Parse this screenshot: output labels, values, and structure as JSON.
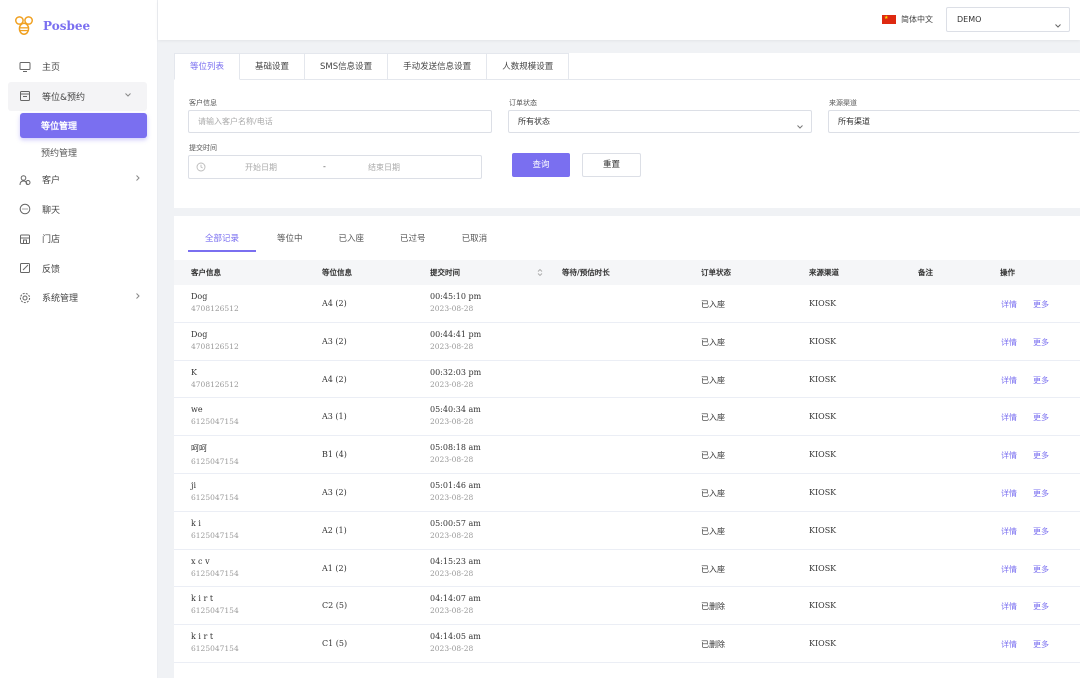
{
  "app": {
    "name": "Posbee"
  },
  "header": {
    "language": "简体中文",
    "store": "DEMO"
  },
  "sidebar": {
    "items": [
      {
        "label": "主页",
        "icon": "monitor-icon"
      },
      {
        "label": "等位&预约",
        "icon": "queue-icon",
        "open": true,
        "children": [
          {
            "label": "等位管理",
            "active": true
          },
          {
            "label": "预约管理"
          }
        ]
      },
      {
        "label": "客户",
        "icon": "customers-icon",
        "has_children": true
      },
      {
        "label": "聊天",
        "icon": "chat-icon"
      },
      {
        "label": "门店",
        "icon": "store-icon"
      },
      {
        "label": "反馈",
        "icon": "feedback-icon"
      },
      {
        "label": "系统管理",
        "icon": "settings-icon",
        "has_children": true
      }
    ]
  },
  "top_tabs": [
    "等位列表",
    "基础设置",
    "SMS信息设置",
    "手动发送信息设置",
    "人数规模设置"
  ],
  "filters": {
    "customer_label": "客户信息",
    "customer_placeholder": "请输入客户名称/电话",
    "status_label": "订单状态",
    "status_value": "所有状态",
    "channel_label": "来源渠道",
    "channel_value": "所有渠道",
    "time_label": "提交时间",
    "start_placeholder": "开始日期",
    "separator": "-",
    "end_placeholder": "结束日期",
    "search_label": "查询",
    "reset_label": "重置"
  },
  "sub_tabs": [
    "全部记录",
    "等位中",
    "已入座",
    "已过号",
    "已取消"
  ],
  "table": {
    "headers": [
      "客户信息",
      "等位信息",
      "提交时间",
      "等待/预估时长",
      "订单状态",
      "来源渠道",
      "备注",
      "操作"
    ],
    "action_detail": "详情",
    "action_more": "更多",
    "rows": [
      {
        "name": "Dog",
        "phone": "4708126512",
        "queue": "A4 (2)",
        "time": "00:45:10 pm",
        "date": "2023-08-28",
        "status": "已入座",
        "channel": "KIOSK"
      },
      {
        "name": "Dog",
        "phone": "4708126512",
        "queue": "A3 (2)",
        "time": "00:44:41 pm",
        "date": "2023-08-28",
        "status": "已入座",
        "channel": "KIOSK"
      },
      {
        "name": "K",
        "phone": "4708126512",
        "queue": "A4 (2)",
        "time": "00:32:03 pm",
        "date": "2023-08-28",
        "status": "已入座",
        "channel": "KIOSK"
      },
      {
        "name": "we",
        "phone": "6125047154",
        "queue": "A3 (1)",
        "time": "05:40:34 am",
        "date": "2023-08-28",
        "status": "已入座",
        "channel": "KIOSK"
      },
      {
        "name": "呵呵",
        "phone": "6125047154",
        "queue": "B1 (4)",
        "time": "05:08:18 am",
        "date": "2023-08-28",
        "status": "已入座",
        "channel": "KIOSK"
      },
      {
        "name": "ji",
        "phone": "6125047154",
        "queue": "A3 (2)",
        "time": "05:01:46 am",
        "date": "2023-08-28",
        "status": "已入座",
        "channel": "KIOSK"
      },
      {
        "name": "k i",
        "phone": "6125047154",
        "queue": "A2 (1)",
        "time": "05:00:57 am",
        "date": "2023-08-28",
        "status": "已入座",
        "channel": "KIOSK"
      },
      {
        "name": "x c v",
        "phone": "6125047154",
        "queue": "A1 (2)",
        "time": "04:15:23 am",
        "date": "2023-08-28",
        "status": "已入座",
        "channel": "KIOSK"
      },
      {
        "name": "k i r t",
        "phone": "6125047154",
        "queue": "C2 (5)",
        "time": "04:14:07 am",
        "date": "2023-08-28",
        "status": "已删除",
        "channel": "KIOSK"
      },
      {
        "name": "k i r t",
        "phone": "6125047154",
        "queue": "C1 (5)",
        "time": "04:14:05 am",
        "date": "2023-08-28",
        "status": "已删除",
        "channel": "KIOSK"
      }
    ]
  }
}
